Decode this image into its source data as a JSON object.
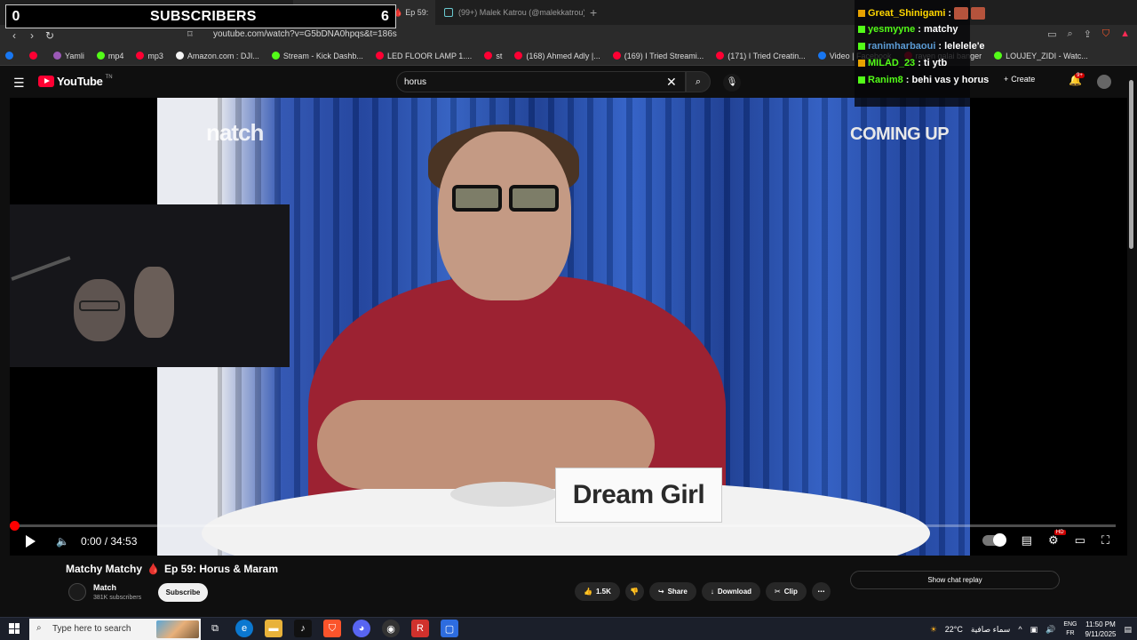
{
  "browser": {
    "tabs": [
      {
        "label": "(161) Matchy Matchy 🩸 Ep 59:",
        "active": true
      },
      {
        "label": "(99+) Malek Katrou (@malekkatrou) |",
        "active": false
      }
    ],
    "url": "youtube.com/watch?v=G5bDNA0hpqs&t=186s",
    "bookmarks": [
      {
        "label": "",
        "color": "#1877f2"
      },
      {
        "label": "",
        "color": "#ff0033"
      },
      {
        "label": "Yamli",
        "color": "#9b59b6"
      },
      {
        "label": "mp4",
        "color": "#53fc18"
      },
      {
        "label": "mp3",
        "color": "#ff0033"
      },
      {
        "label": "Amazon.com : DJI...",
        "color": "#f5f5f5"
      },
      {
        "label": "Stream - Kick Dashb...",
        "color": "#53fc18"
      },
      {
        "label": "LED FLOOR LAMP 1....",
        "color": "#ff0033"
      },
      {
        "label": "st",
        "color": "#ff0033"
      },
      {
        "label": "(168) Ahmed Adly |...",
        "color": "#ff0033"
      },
      {
        "label": "(169) I Tried Streami...",
        "color": "#ff0033"
      },
      {
        "label": "(171) I Tried Creatin...",
        "color": "#ff0033"
      },
      {
        "label": "Video | Facebook",
        "color": "#1877f2"
      },
      {
        "label": "rayen galai banger",
        "color": "#ff0033"
      },
      {
        "label": "LOUJEY_ZIDI - Watc...",
        "color": "#53fc18"
      }
    ]
  },
  "overlay": {
    "subs_left": "0",
    "subs_label": "SUBSCRIBERS",
    "subs_right": "6"
  },
  "youtube": {
    "logo_text": "YouTube",
    "logo_tn": "TN",
    "search_value": "horus",
    "create_label": "Create",
    "notif_count": "9+"
  },
  "chat": [
    {
      "user": "Great_Shinigami",
      "msg": ":",
      "color": "#ffd700",
      "emotes": 2
    },
    {
      "user": "yesmyyne",
      "msg": ": matchy",
      "color": "#53fc18",
      "emotes": 0
    },
    {
      "user": "ranimharbaoui",
      "msg": ": lelelele'e",
      "color": "#5b9bd5",
      "emotes": 0
    },
    {
      "user": "MILAD_23",
      "msg": ": ti ytb",
      "color": "#53fc18",
      "emotes": 0
    },
    {
      "user": "Ranim8",
      "msg": ": behi vas y horus",
      "color": "#53fc18",
      "emotes": 0
    }
  ],
  "video": {
    "brand_overlay": "natch",
    "coming_up": "COMING UP",
    "nameplate": "Dream Girl",
    "time": "0:00 / 34:53",
    "progress": 0.0
  },
  "meta": {
    "title_a": "Matchy Matchy",
    "title_b": "Ep 59: Horus & Maram",
    "channel": "Match",
    "subscribers": "381K subscribers",
    "subscribe_label": "Subscribe",
    "likes": "1.5K",
    "share_label": "Share",
    "download_label": "Download",
    "clip_label": "Clip",
    "chat_replay_label": "Show chat replay"
  },
  "taskbar": {
    "search_placeholder": "Type here to search",
    "weather": "22°C",
    "weather_desc": "سماء صافية",
    "lang_top": "ENG",
    "lang_bottom": "FR",
    "time": "11:50 PM",
    "date": "9/11/2025"
  }
}
